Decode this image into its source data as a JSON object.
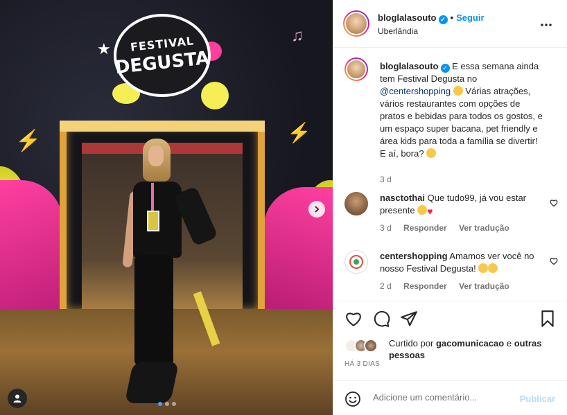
{
  "post": {
    "slide_count": 3,
    "active_slide": 1
  },
  "header": {
    "username": "bloglalasouto",
    "separator": "•",
    "follow_label": "Seguir",
    "location": "Uberlândia",
    "more_icon": "more-horizontal-icon"
  },
  "media_text": {
    "logo_line1": "FESTIVAL",
    "logo_line2": "DEGUSTA"
  },
  "caption": {
    "username": "bloglalasouto",
    "text_before": "E essa semana ainda tem Festival Degusta no",
    "mention": "@centershopping",
    "text_after": "Várias atrações, vários restaurantes com opções de pratos e bebidas para todos os gostos, e um espaço super bacana, pet friendly e área kids para toda a família se divertir! E aí, bora?",
    "time": "3 d"
  },
  "comments": [
    {
      "username": "nasctothai",
      "text": "Que tudo99, já vou estar presente",
      "time": "3 d",
      "reply_label": "Responder",
      "translate_label": "Ver tradução"
    },
    {
      "username": "centershopping",
      "text": "Amamos ver você no nosso Festival Degusta!",
      "time": "2 d",
      "reply_label": "Responder",
      "translate_label": "Ver tradução"
    }
  ],
  "likes": {
    "prefix": "Curtido por",
    "user": "gacomunicacao",
    "joiner": "e",
    "others": "outras pessoas"
  },
  "timestamp": "HÁ 3 DIAS",
  "add_comment": {
    "placeholder": "Adicione um comentário...",
    "publish_label": "Publicar"
  },
  "colors": {
    "accent": "#0095f6",
    "publish_disabled": "#b3dbff",
    "meta_text": "#737373",
    "heart_red": "#e0245e"
  }
}
